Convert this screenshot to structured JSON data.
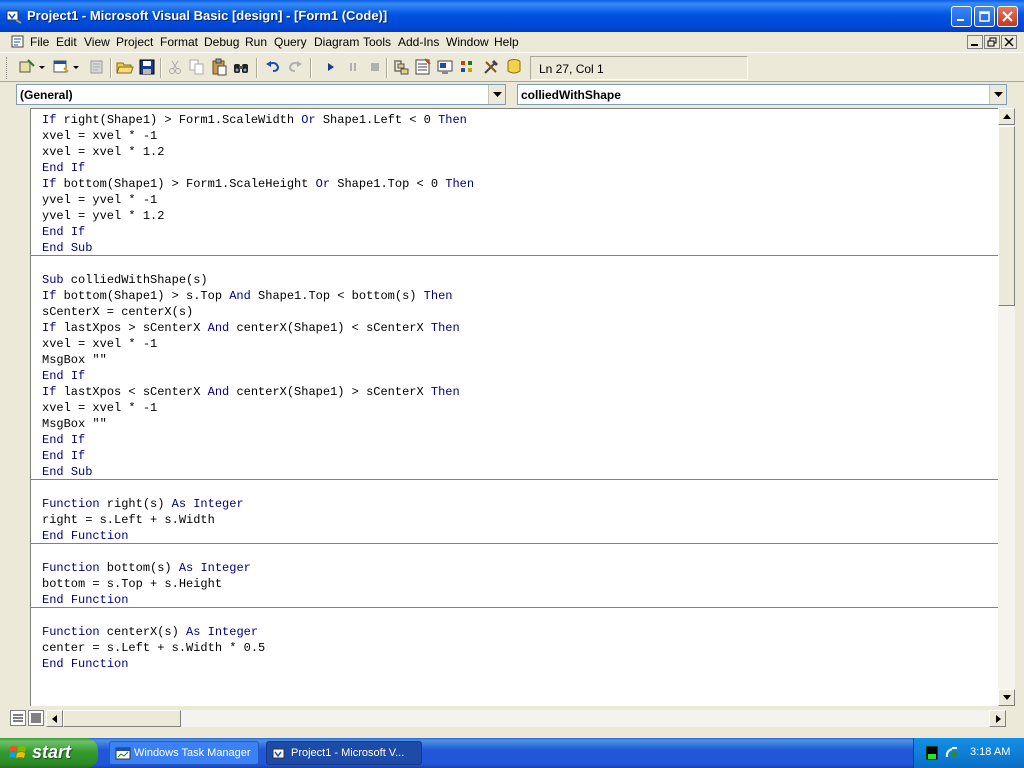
{
  "window": {
    "title": "Project1 - Microsoft Visual Basic [design] - [Form1 (Code)]"
  },
  "menubar": {
    "items": [
      "File",
      "Edit",
      "View",
      "Project",
      "Format",
      "Debug",
      "Run",
      "Query",
      "Diagram",
      "Tools",
      "Add-Ins",
      "Window",
      "Help"
    ]
  },
  "toolbar": {
    "cursor_position": "Ln 27, Col 1"
  },
  "combos": {
    "object": "(General)",
    "procedure": "colliedWithShape"
  },
  "code": {
    "lines": [
      "If right(Shape1) > Form1.ScaleWidth Or Shape1.Left < 0 Then",
      "xvel = xvel * -1",
      "xvel = xvel * 1.2",
      "End If",
      "If bottom(Shape1) > Form1.ScaleHeight Or Shape1.Top < 0 Then",
      "yvel = yvel * -1",
      "yvel = yvel * 1.2",
      "End If",
      "End Sub",
      "",
      "Sub colliedWithShape(s)",
      "If bottom(Shape1) > s.Top And Shape1.Top < bottom(s) Then",
      "sCenterX = centerX(s)",
      "If lastXpos > sCenterX And centerX(Shape1) < sCenterX Then",
      "xvel = xvel * -1",
      "MsgBox \"\"",
      "End If",
      "If lastXpos < sCenterX And centerX(Shape1) > sCenterX Then",
      "xvel = xvel * -1",
      "MsgBox \"\"",
      "End If",
      "End If",
      "End Sub",
      "",
      "Function right(s) As Integer",
      "right = s.Left + s.Width",
      "End Function",
      "",
      "Function bottom(s) As Integer",
      "bottom = s.Top + s.Height",
      "End Function",
      "",
      "Function centerX(s) As Integer",
      "center = s.Left + s.Width * 0.5",
      "End Function"
    ]
  },
  "taskbar": {
    "start_label": "start",
    "tasks": [
      {
        "label": "Windows Task Manager",
        "active": false
      },
      {
        "label": "Project1 - Microsoft V...",
        "active": true
      }
    ],
    "clock": "3:18 AM"
  },
  "colors": {
    "keyword": "#00007f",
    "titlebar": "#0054e3",
    "taskbar": "#2157d7",
    "start": "#379b31"
  }
}
